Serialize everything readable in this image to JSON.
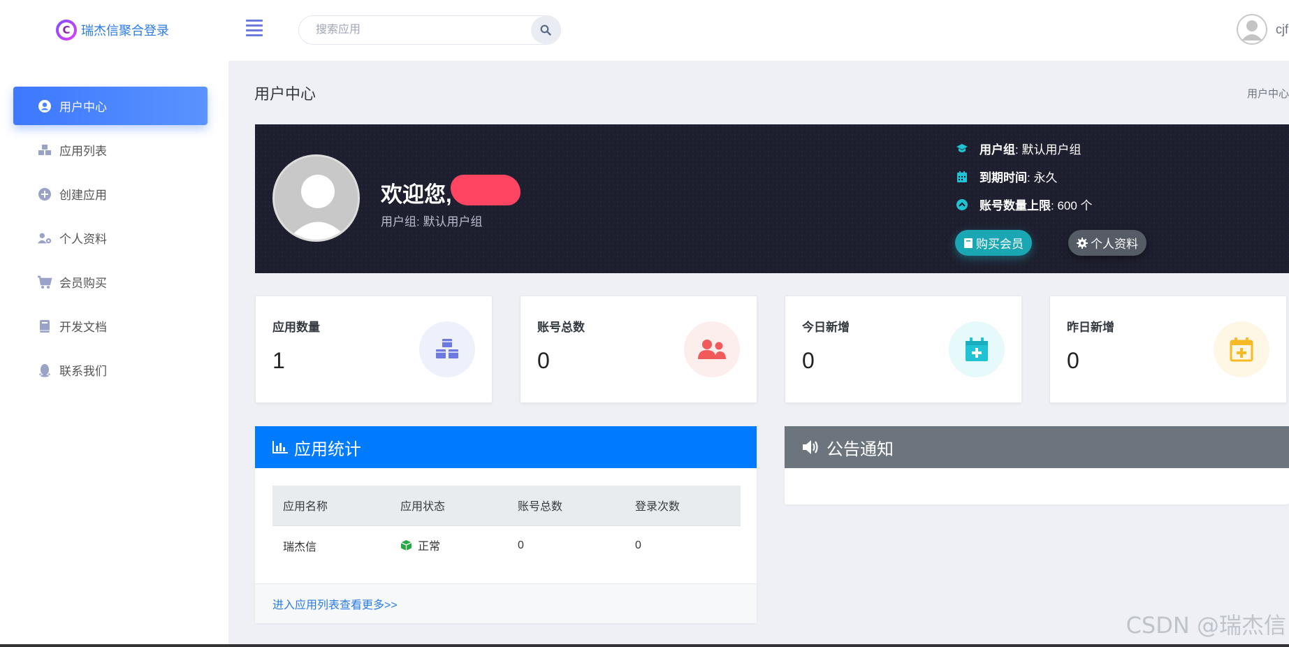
{
  "app": {
    "brand_name": "瑞杰信聚合登录",
    "brand_letter": "C"
  },
  "search": {
    "placeholder": "搜索应用"
  },
  "user": {
    "name": "cjf"
  },
  "sidebar": {
    "items": [
      {
        "label": "用户中心",
        "icon": "user-circle-icon",
        "active": true
      },
      {
        "label": "应用列表",
        "icon": "cubes-icon"
      },
      {
        "label": "创建应用",
        "icon": "plus-circle-icon"
      },
      {
        "label": "个人资料",
        "icon": "user-cog-icon"
      },
      {
        "label": "会员购买",
        "icon": "cart-icon"
      },
      {
        "label": "开发文档",
        "icon": "book-icon"
      },
      {
        "label": "联系我们",
        "icon": "qq-icon"
      }
    ]
  },
  "page": {
    "title": "用户中心",
    "breadcrumb": "用户中心"
  },
  "banner": {
    "welcome": "欢迎您,",
    "sub": "用户组:  默认用户组",
    "info": [
      {
        "label": "用户组",
        "value": " : 默认用户组",
        "icon": "graduation-icon"
      },
      {
        "label": "到期时间",
        "value": " : 永久",
        "icon": "calendar-icon"
      },
      {
        "label": "账号数量上限",
        "value": " : 600 个",
        "icon": "chevron-up-circle-icon"
      }
    ],
    "buy_label": "购买会员",
    "profile_label": "个人资料"
  },
  "stats": [
    {
      "label": "应用数量",
      "value": "1",
      "icon": "cubes-icon",
      "color": "#6c7ae0",
      "bg": "#eef0fc"
    },
    {
      "label": "账号总数",
      "value": "0",
      "icon": "users-icon",
      "color": "#f05a5a",
      "bg": "#fdeeee"
    },
    {
      "label": "今日新增",
      "value": "0",
      "icon": "calendar-plus-icon",
      "color": "#1fc3d3",
      "bg": "#e6f9fb"
    },
    {
      "label": "昨日新增",
      "value": "0",
      "icon": "calendar-plus-icon",
      "color": "#f7b924",
      "bg": "#fef7e5"
    }
  ],
  "app_stats": {
    "title": "应用统计",
    "headers": [
      "应用名称",
      "应用状态",
      "账号总数",
      "登录次数"
    ],
    "rows": [
      {
        "name": "瑞杰信",
        "status": "正常",
        "accounts": "0",
        "logins": "0"
      }
    ],
    "footer": "进入应用列表查看更多>>"
  },
  "notice": {
    "title": "公告通知"
  },
  "watermark": "CSDN @瑞杰信",
  "colors": {
    "primary": "#3d78ff",
    "panel_blue": "#007bff",
    "panel_gray": "#6c757d",
    "banner": "#1e1f2e"
  }
}
